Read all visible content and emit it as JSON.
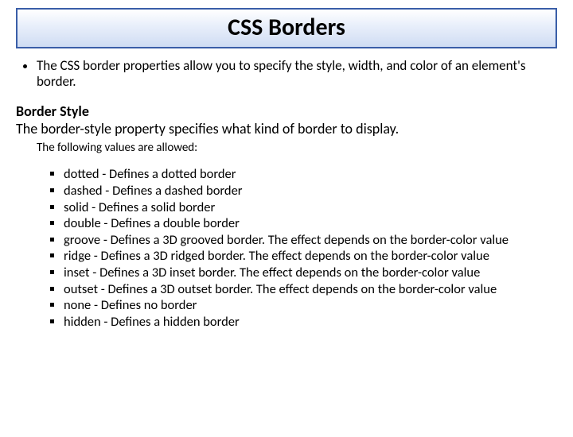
{
  "title": "CSS Borders",
  "intro": "The CSS border properties allow you to specify the style, width, and color of an element's border.",
  "section": {
    "heading": "Border Style",
    "subheading": "The border-style property specifies what kind of border to display.",
    "allowed_intro": "The following values are allowed:"
  },
  "values": [
    "dotted - Defines a dotted border",
    "dashed - Defines a dashed border",
    "solid - Defines a solid border",
    "double - Defines a double border",
    "groove - Defines a 3D grooved border. The effect depends on the border-color value",
    "ridge - Defines a 3D ridged border. The effect depends on the border-color value",
    "inset - Defines a 3D inset border. The effect depends on the border-color value",
    "outset - Defines a 3D outset border. The effect depends on the border-color value",
    "none - Defines no border",
    "hidden - Defines a hidden border"
  ]
}
